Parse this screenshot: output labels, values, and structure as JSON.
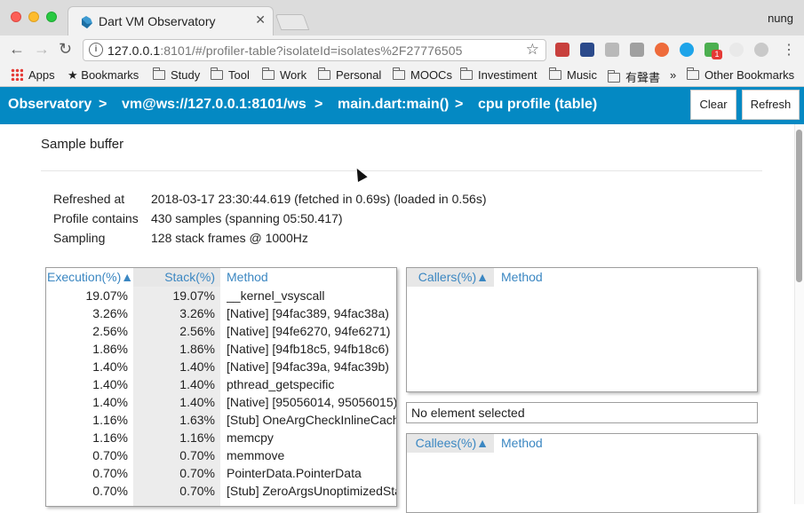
{
  "browser": {
    "tab_title": "Dart VM Observatory",
    "tab_close": "✕",
    "profile_name": "nung",
    "url_host": "127.0.0.1",
    "url_rest": ":8101/#/profiler-table?isolateId=isolates%2F27776505",
    "info_icon": "i",
    "back_glyph": "←",
    "forward_glyph": "→",
    "reload_glyph": "↻",
    "star_glyph": "☆",
    "menu_glyph": "⋮",
    "ext_badge": "1",
    "bookmarks": [
      {
        "label": "Apps"
      },
      {
        "label": "Bookmarks"
      },
      {
        "label": "Study"
      },
      {
        "label": "Tool"
      },
      {
        "label": "Work"
      },
      {
        "label": "Personal"
      },
      {
        "label": "MOOCs"
      },
      {
        "label": "Investiment"
      },
      {
        "label": "Music"
      },
      {
        "label": "有聲書"
      },
      {
        "label": "»"
      },
      {
        "label": "Other Bookmarks"
      }
    ]
  },
  "observatory": {
    "crumbs": [
      "Observatory",
      ">",
      "vm@ws://127.0.0.1:8101/ws",
      ">",
      "main.dart:main()",
      ">",
      "cpu profile (table)"
    ],
    "clear_label": "Clear",
    "refresh_label": "Refresh"
  },
  "sample_buffer": {
    "title": "Sample buffer",
    "rows": [
      {
        "key": "Refreshed at",
        "value": "2018-03-17 23:30:44.619 (fetched in 0.69s) (loaded in 0.56s)"
      },
      {
        "key": "Profile contains",
        "value": "430 samples (spanning 05:50.417)"
      },
      {
        "key": "Sampling",
        "value": "128 stack frames @ 1000Hz"
      }
    ]
  },
  "functions_table": {
    "headers": {
      "execution": "Execution(%)▲",
      "stack": "Stack(%)",
      "method": "Method"
    },
    "rows": [
      {
        "execution": "19.07%",
        "stack": "19.07%",
        "method": "__kernel_vsyscall"
      },
      {
        "execution": "3.26%",
        "stack": "3.26%",
        "method": "[Native] [94fac389, 94fac38a)"
      },
      {
        "execution": "2.56%",
        "stack": "2.56%",
        "method": "[Native] [94fe6270, 94fe6271)"
      },
      {
        "execution": "1.86%",
        "stack": "1.86%",
        "method": "[Native] [94fb18c5, 94fb18c6)"
      },
      {
        "execution": "1.40%",
        "stack": "1.40%",
        "method": "[Native] [94fac39a, 94fac39b)"
      },
      {
        "execution": "1.40%",
        "stack": "1.40%",
        "method": "pthread_getspecific"
      },
      {
        "execution": "1.40%",
        "stack": "1.40%",
        "method": "[Native] [95056014, 95056015)"
      },
      {
        "execution": "1.16%",
        "stack": "1.63%",
        "method": "[Stub] OneArgCheckInlineCache"
      },
      {
        "execution": "1.16%",
        "stack": "1.16%",
        "method": "memcpy"
      },
      {
        "execution": "0.70%",
        "stack": "0.70%",
        "method": "memmove"
      },
      {
        "execution": "0.70%",
        "stack": "0.70%",
        "method": "PointerData.PointerData"
      },
      {
        "execution": "0.70%",
        "stack": "0.70%",
        "method": "[Stub] ZeroArgsUnoptimizedStaticCall"
      }
    ]
  },
  "callers_table": {
    "headers": {
      "pct": "Callers(%)▲",
      "method": "Method"
    }
  },
  "selection_status": "No element selected",
  "callees_table": {
    "headers": {
      "pct": "Callees(%)▲",
      "method": "Method"
    }
  }
}
